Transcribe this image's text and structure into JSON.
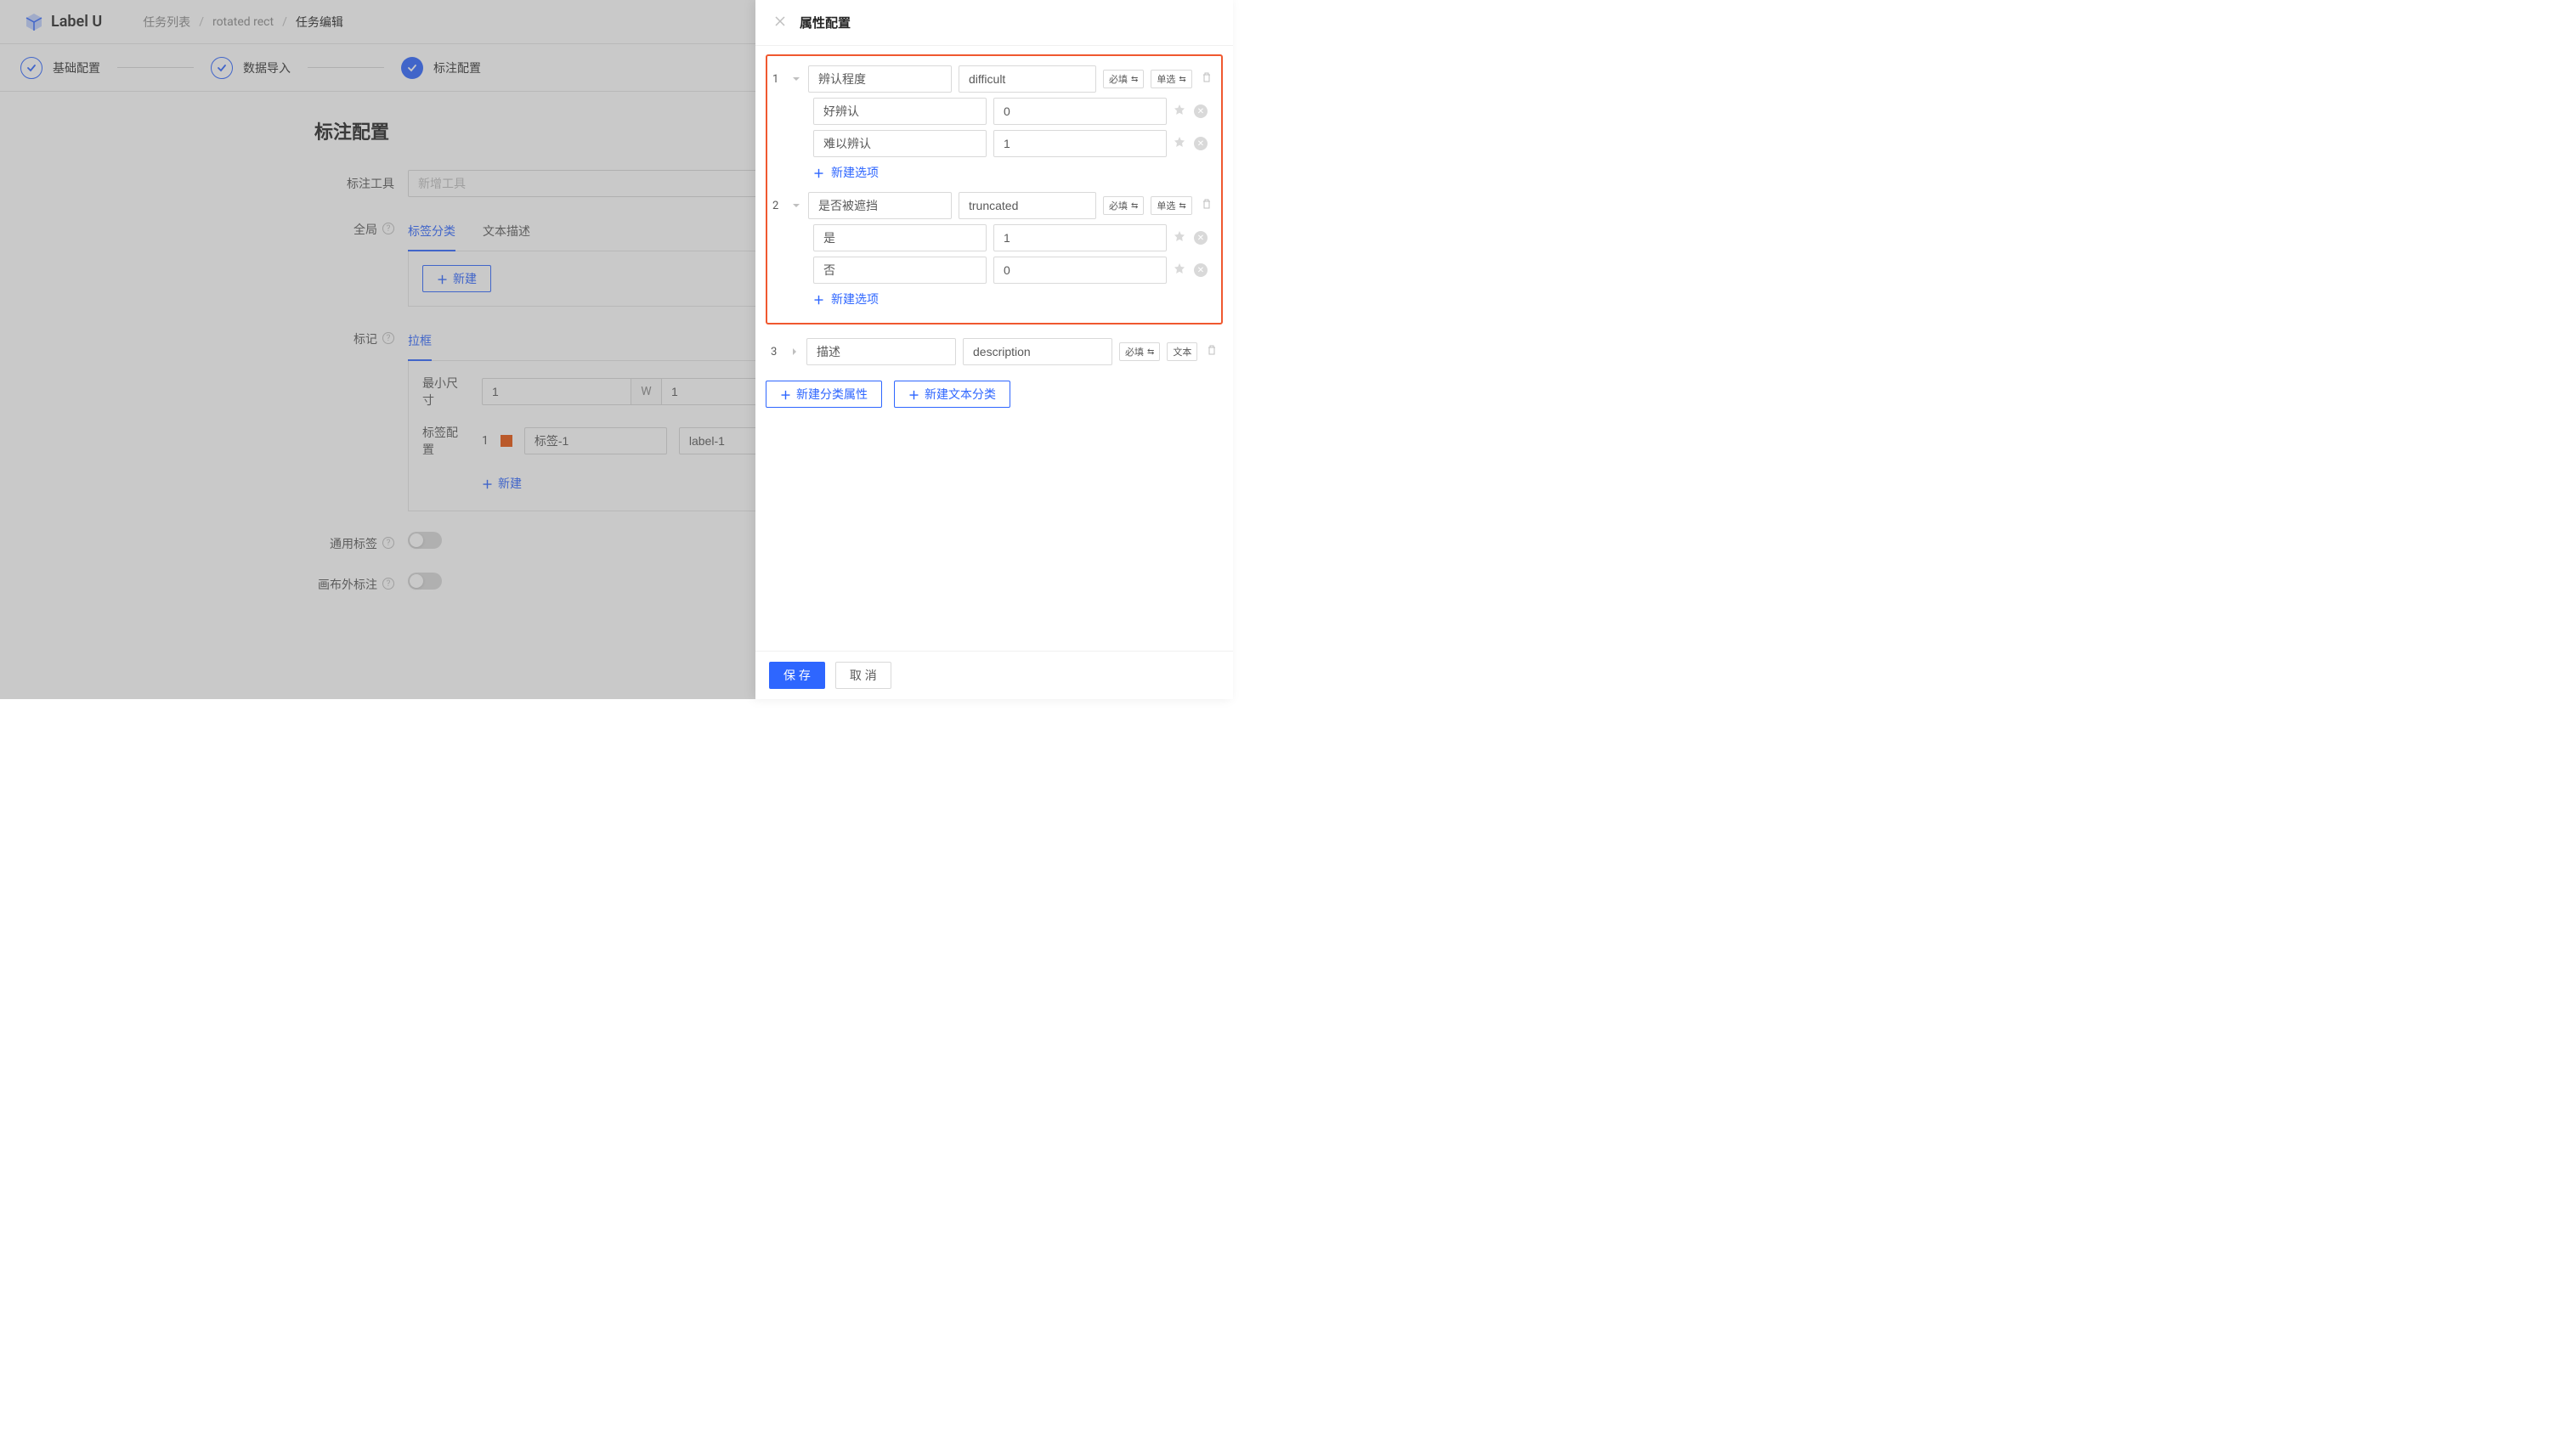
{
  "brand": "Label U",
  "breadcrumb": {
    "item1": "任务列表",
    "item2": "rotated rect",
    "item3": "任务编辑"
  },
  "steps": {
    "s1": "基础配置",
    "s2": "数据导入",
    "s3": "标注配置"
  },
  "page": {
    "title": "标注配置",
    "tool_label": "标注工具",
    "tool_placeholder": "新增工具",
    "global_label": "全局",
    "global_tabs": {
      "tag": "标签分类",
      "text": "文本描述"
    },
    "new_btn": "新建",
    "mark_label": "标记",
    "mark_tab": "拉框",
    "min_size_label": "最小尺寸",
    "min_size_w": "1",
    "min_size_unit": "W",
    "min_size_h": "1",
    "label_config_label": "标签配置",
    "label_count": "1",
    "label_name_value": "标签-1",
    "label_value_value": "label-1",
    "add_label": "新建",
    "common_label": "通用标签",
    "canvas_label": "画布外标注"
  },
  "drawer": {
    "title": "属性配置",
    "required": "必填",
    "single": "单选",
    "text_type": "文本",
    "add_opt": "新建选项",
    "add_cat": "新建分类属性",
    "add_text": "新建文本分类",
    "attrs": [
      {
        "num": "1",
        "expanded": true,
        "name": "辨认程度",
        "value": "difficult",
        "toggles": [
          "required",
          "single"
        ],
        "options": [
          {
            "label": "好辨认",
            "val": "0"
          },
          {
            "label": "难以辨认",
            "val": "1"
          }
        ]
      },
      {
        "num": "2",
        "expanded": true,
        "name": "是否被遮挡",
        "value": "truncated",
        "toggles": [
          "required",
          "single"
        ],
        "options": [
          {
            "label": "是",
            "val": "1"
          },
          {
            "label": "否",
            "val": "0"
          }
        ]
      }
    ],
    "attr3": {
      "num": "3",
      "name": "描述",
      "value": "description"
    },
    "save": "保 存",
    "cancel": "取 消"
  }
}
